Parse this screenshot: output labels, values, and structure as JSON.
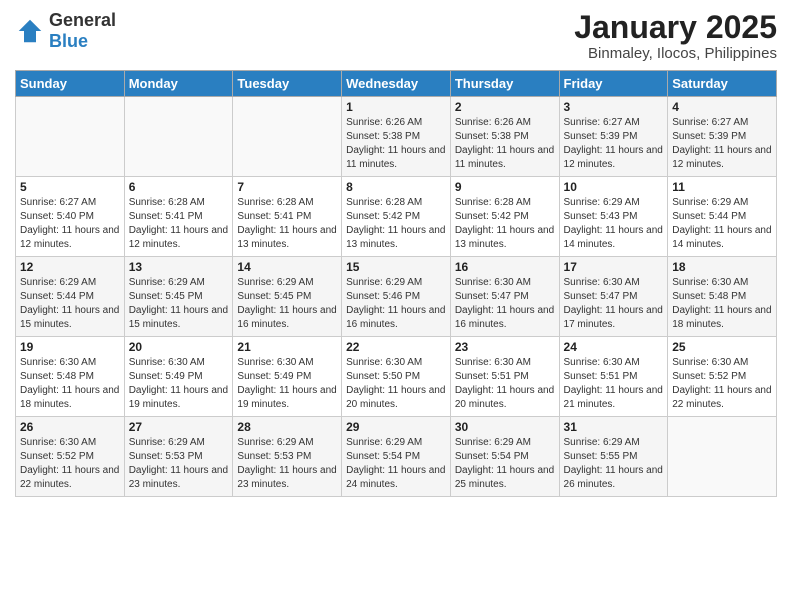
{
  "logo": {
    "general": "General",
    "blue": "Blue"
  },
  "title": "January 2025",
  "subtitle": "Binmaley, Ilocos, Philippines",
  "weekdays": [
    "Sunday",
    "Monday",
    "Tuesday",
    "Wednesday",
    "Thursday",
    "Friday",
    "Saturday"
  ],
  "weeks": [
    [
      {
        "day": "",
        "sunrise": "",
        "sunset": "",
        "daylight": ""
      },
      {
        "day": "",
        "sunrise": "",
        "sunset": "",
        "daylight": ""
      },
      {
        "day": "",
        "sunrise": "",
        "sunset": "",
        "daylight": ""
      },
      {
        "day": "1",
        "sunrise": "Sunrise: 6:26 AM",
        "sunset": "Sunset: 5:38 PM",
        "daylight": "Daylight: 11 hours and 11 minutes."
      },
      {
        "day": "2",
        "sunrise": "Sunrise: 6:26 AM",
        "sunset": "Sunset: 5:38 PM",
        "daylight": "Daylight: 11 hours and 11 minutes."
      },
      {
        "day": "3",
        "sunrise": "Sunrise: 6:27 AM",
        "sunset": "Sunset: 5:39 PM",
        "daylight": "Daylight: 11 hours and 12 minutes."
      },
      {
        "day": "4",
        "sunrise": "Sunrise: 6:27 AM",
        "sunset": "Sunset: 5:39 PM",
        "daylight": "Daylight: 11 hours and 12 minutes."
      }
    ],
    [
      {
        "day": "5",
        "sunrise": "Sunrise: 6:27 AM",
        "sunset": "Sunset: 5:40 PM",
        "daylight": "Daylight: 11 hours and 12 minutes."
      },
      {
        "day": "6",
        "sunrise": "Sunrise: 6:28 AM",
        "sunset": "Sunset: 5:41 PM",
        "daylight": "Daylight: 11 hours and 12 minutes."
      },
      {
        "day": "7",
        "sunrise": "Sunrise: 6:28 AM",
        "sunset": "Sunset: 5:41 PM",
        "daylight": "Daylight: 11 hours and 13 minutes."
      },
      {
        "day": "8",
        "sunrise": "Sunrise: 6:28 AM",
        "sunset": "Sunset: 5:42 PM",
        "daylight": "Daylight: 11 hours and 13 minutes."
      },
      {
        "day": "9",
        "sunrise": "Sunrise: 6:28 AM",
        "sunset": "Sunset: 5:42 PM",
        "daylight": "Daylight: 11 hours and 13 minutes."
      },
      {
        "day": "10",
        "sunrise": "Sunrise: 6:29 AM",
        "sunset": "Sunset: 5:43 PM",
        "daylight": "Daylight: 11 hours and 14 minutes."
      },
      {
        "day": "11",
        "sunrise": "Sunrise: 6:29 AM",
        "sunset": "Sunset: 5:44 PM",
        "daylight": "Daylight: 11 hours and 14 minutes."
      }
    ],
    [
      {
        "day": "12",
        "sunrise": "Sunrise: 6:29 AM",
        "sunset": "Sunset: 5:44 PM",
        "daylight": "Daylight: 11 hours and 15 minutes."
      },
      {
        "day": "13",
        "sunrise": "Sunrise: 6:29 AM",
        "sunset": "Sunset: 5:45 PM",
        "daylight": "Daylight: 11 hours and 15 minutes."
      },
      {
        "day": "14",
        "sunrise": "Sunrise: 6:29 AM",
        "sunset": "Sunset: 5:45 PM",
        "daylight": "Daylight: 11 hours and 16 minutes."
      },
      {
        "day": "15",
        "sunrise": "Sunrise: 6:29 AM",
        "sunset": "Sunset: 5:46 PM",
        "daylight": "Daylight: 11 hours and 16 minutes."
      },
      {
        "day": "16",
        "sunrise": "Sunrise: 6:30 AM",
        "sunset": "Sunset: 5:47 PM",
        "daylight": "Daylight: 11 hours and 16 minutes."
      },
      {
        "day": "17",
        "sunrise": "Sunrise: 6:30 AM",
        "sunset": "Sunset: 5:47 PM",
        "daylight": "Daylight: 11 hours and 17 minutes."
      },
      {
        "day": "18",
        "sunrise": "Sunrise: 6:30 AM",
        "sunset": "Sunset: 5:48 PM",
        "daylight": "Daylight: 11 hours and 18 minutes."
      }
    ],
    [
      {
        "day": "19",
        "sunrise": "Sunrise: 6:30 AM",
        "sunset": "Sunset: 5:48 PM",
        "daylight": "Daylight: 11 hours and 18 minutes."
      },
      {
        "day": "20",
        "sunrise": "Sunrise: 6:30 AM",
        "sunset": "Sunset: 5:49 PM",
        "daylight": "Daylight: 11 hours and 19 minutes."
      },
      {
        "day": "21",
        "sunrise": "Sunrise: 6:30 AM",
        "sunset": "Sunset: 5:49 PM",
        "daylight": "Daylight: 11 hours and 19 minutes."
      },
      {
        "day": "22",
        "sunrise": "Sunrise: 6:30 AM",
        "sunset": "Sunset: 5:50 PM",
        "daylight": "Daylight: 11 hours and 20 minutes."
      },
      {
        "day": "23",
        "sunrise": "Sunrise: 6:30 AM",
        "sunset": "Sunset: 5:51 PM",
        "daylight": "Daylight: 11 hours and 20 minutes."
      },
      {
        "day": "24",
        "sunrise": "Sunrise: 6:30 AM",
        "sunset": "Sunset: 5:51 PM",
        "daylight": "Daylight: 11 hours and 21 minutes."
      },
      {
        "day": "25",
        "sunrise": "Sunrise: 6:30 AM",
        "sunset": "Sunset: 5:52 PM",
        "daylight": "Daylight: 11 hours and 22 minutes."
      }
    ],
    [
      {
        "day": "26",
        "sunrise": "Sunrise: 6:30 AM",
        "sunset": "Sunset: 5:52 PM",
        "daylight": "Daylight: 11 hours and 22 minutes."
      },
      {
        "day": "27",
        "sunrise": "Sunrise: 6:29 AM",
        "sunset": "Sunset: 5:53 PM",
        "daylight": "Daylight: 11 hours and 23 minutes."
      },
      {
        "day": "28",
        "sunrise": "Sunrise: 6:29 AM",
        "sunset": "Sunset: 5:53 PM",
        "daylight": "Daylight: 11 hours and 23 minutes."
      },
      {
        "day": "29",
        "sunrise": "Sunrise: 6:29 AM",
        "sunset": "Sunset: 5:54 PM",
        "daylight": "Daylight: 11 hours and 24 minutes."
      },
      {
        "day": "30",
        "sunrise": "Sunrise: 6:29 AM",
        "sunset": "Sunset: 5:54 PM",
        "daylight": "Daylight: 11 hours and 25 minutes."
      },
      {
        "day": "31",
        "sunrise": "Sunrise: 6:29 AM",
        "sunset": "Sunset: 5:55 PM",
        "daylight": "Daylight: 11 hours and 26 minutes."
      },
      {
        "day": "",
        "sunrise": "",
        "sunset": "",
        "daylight": ""
      }
    ]
  ]
}
